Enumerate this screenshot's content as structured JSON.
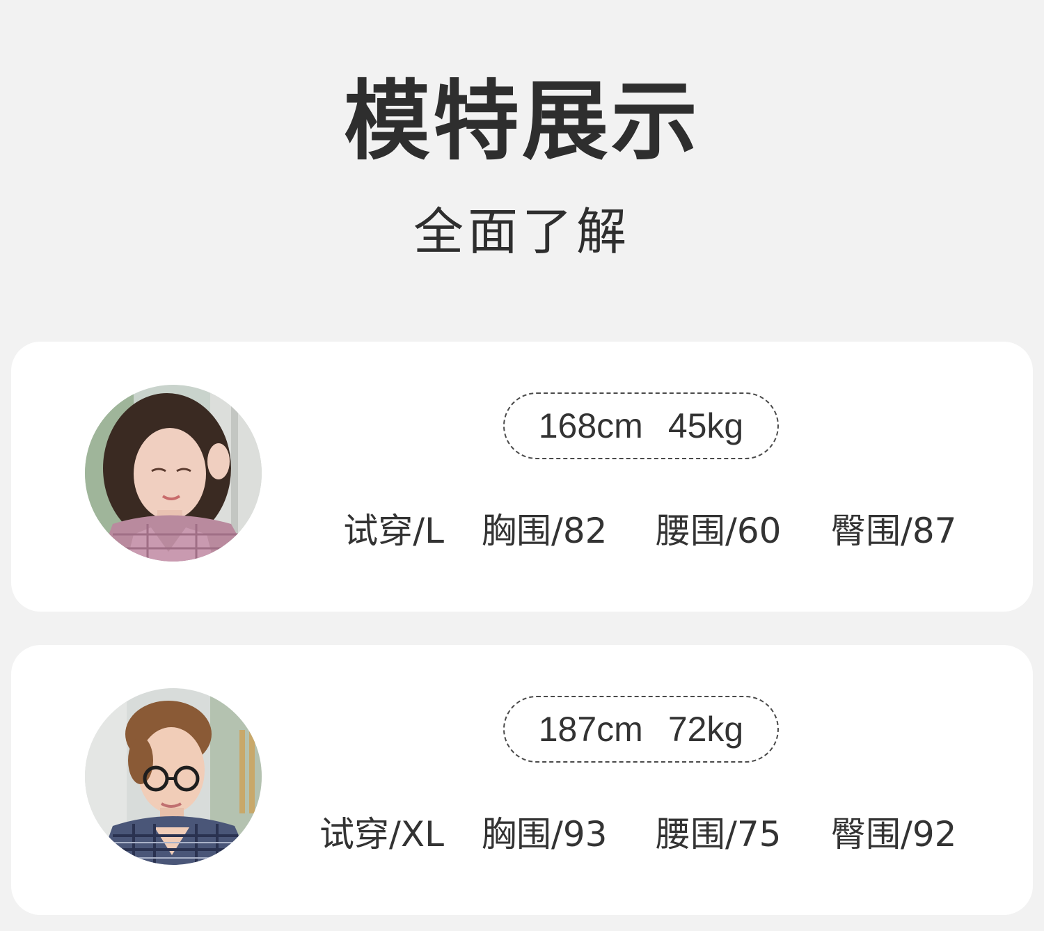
{
  "header": {
    "title": "模特展示",
    "subtitle": "全面了解"
  },
  "models": [
    {
      "photo": "female-model-photo",
      "height": "168cm",
      "weight": "45kg",
      "try_size": "试穿/L",
      "chest": "胸围/82",
      "waist": "腰围/60",
      "hip": "臀围/87"
    },
    {
      "photo": "male-model-photo",
      "height": "187cm",
      "weight": "72kg",
      "try_size": "试穿/XL",
      "chest": "胸围/93",
      "waist": "腰围/75",
      "hip": "臀围/92"
    }
  ],
  "colors": {
    "background": "#f2f2f2",
    "card": "#ffffff",
    "text": "#333333"
  }
}
